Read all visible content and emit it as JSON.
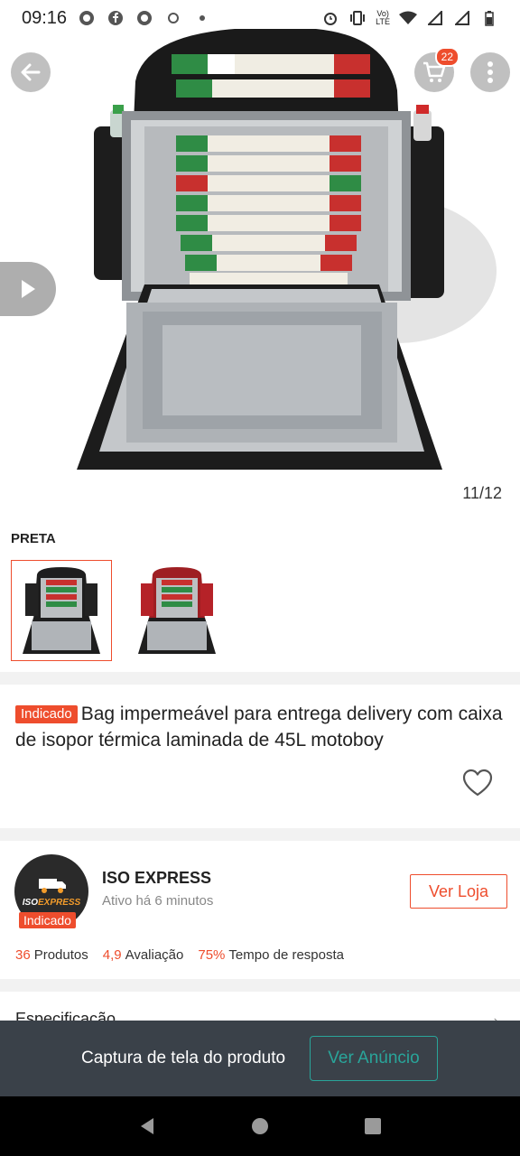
{
  "status_bar": {
    "time": "09:16",
    "network_label_top": "Vo)",
    "network_label_bottom": "LTE"
  },
  "hero": {
    "cart_count": "22",
    "page_counter": "11/12"
  },
  "variants": {
    "label": "PRETA"
  },
  "product": {
    "tag": "Indicado",
    "title": "Bag impermeável para entrega delivery com caixa de isopor térmica laminada de 45L motoboy"
  },
  "store": {
    "logo_text_a": "ISO",
    "logo_text_b": "EXPRESS",
    "tag": "Indicado",
    "name": "ISO EXPRESS",
    "active": "Ativo há 6 minutos",
    "visit_label": "Ver Loja",
    "stats": [
      {
        "value": "36",
        "label": "Produtos"
      },
      {
        "value": "4,9",
        "label": "Avaliação"
      },
      {
        "value": "75%",
        "label": "Tempo de resposta"
      }
    ]
  },
  "spec": {
    "label": "Especificação"
  },
  "banner": {
    "text": "Captura de tela do produto",
    "button": "Ver Anúncio"
  },
  "colors": {
    "accent": "#ee4d2d",
    "banner_bg": "#3a4149",
    "banner_button": "#29a59a"
  }
}
